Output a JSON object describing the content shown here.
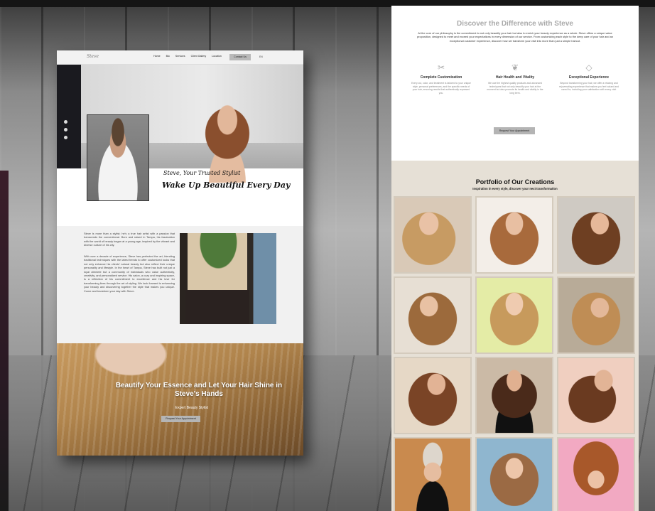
{
  "left_page": {
    "nav": {
      "logo": "Steve",
      "items": [
        "Home",
        "Bio",
        "Services",
        "Client Gallery",
        "Location"
      ],
      "contact": "Contact Us",
      "lang": "EN"
    },
    "hero": {
      "tagline": "Steve, Your Trusted Stylist",
      "headline": "Wake Up Beautiful Every Day"
    },
    "about": {
      "para1": "Steve is more than a stylist; he's a true hair artist with a passion that transcends the conventional. Born and raised in Tampa, his fascination with the world of beauty began at a young age, inspired by the vibrant and diverse culture of his city.",
      "para2": "With over a decade of experience, Steve has perfected the art, blending traditional techniques with the latest trends to offer customized looks that not only enhance his clients' natural beauty but also reflect their unique personality and lifestyle. In the heart of Tampa, Steve has built not just a loyal clientele but a community of individuals who value authenticity, creativity, and personalized service. His salon, a cozy and inspiring space, is a reflection of his commitment to excellence and his love for transforming lives through the art of styling. We look forward to enhancing your beauty and discovering together the style that makes you unique. Come and transform your day with Steve."
    },
    "cta": {
      "line1": "Beautify Your Essence and Let Your Hair Shine in",
      "line2": "Steve's Hands",
      "subtitle": "Expert Beauty Stylist",
      "button": "Request Your Appointment"
    }
  },
  "right_page": {
    "title": "Discover the Difference with Steve",
    "intro": "At the core of our philosophy is the commitment to not only beautify your hair but also to enrich your beauty experience as a whole. Steve offers a unique value proposition, designed to meet and exceed your expectations in every dimension of our service. From customizing each style to the deep care of your hair and an exceptional customer experience, discover how we transform your visit into more than just a simple haircut.",
    "features": [
      {
        "icon": "scissors-icon",
        "title": "Complete Customization",
        "desc": "Every cut, color, and treatment is tailored to your unique style, personal preferences, and the specific needs of your hair, ensuring results that authentically represent you."
      },
      {
        "icon": "leaf-icon",
        "title": "Hair Health and Vitality",
        "desc": "We use the highest quality products and advanced techniques that not only beautify your hair at the moment but also promote its health and vitality in the long term."
      },
      {
        "icon": "diamond-icon",
        "title": "Exceptional Experience",
        "desc": "Beyond transforming your hair, we offer a relaxing and rejuvenating experience that makes you feel valued and cared for, including your satisfaction with every visit."
      }
    ],
    "button": "Request Your Appointment",
    "portfolio": {
      "title": "Portfolio of Our Creations",
      "subtitle": "Inspiration in every style, discover your next transformation"
    }
  }
}
